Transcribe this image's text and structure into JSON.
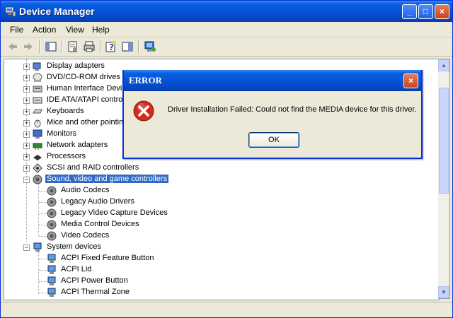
{
  "window": {
    "title": "Device Manager",
    "minimize": "_",
    "maximize": "□",
    "close": "×"
  },
  "menu": [
    {
      "label": "File"
    },
    {
      "label": "Action"
    },
    {
      "label": "View"
    },
    {
      "label": "Help"
    }
  ],
  "toolbar": {
    "icons": [
      "back-arrow-icon",
      "forward-arrow-icon",
      "show-hide-tree-icon",
      "properties-icon",
      "print-icon",
      "help-icon",
      "view-toggle-icon",
      "scan-hardware-icon"
    ]
  },
  "tree": {
    "categories": [
      {
        "label": "Display adapters",
        "icon": "display-adapter-icon",
        "expander": "+"
      },
      {
        "label": "DVD/CD-ROM drives",
        "icon": "cdrom-icon",
        "expander": "+"
      },
      {
        "label": "Human Interface Devic",
        "icon": "hid-icon",
        "expander": "+"
      },
      {
        "label": "IDE ATA/ATAPI contro",
        "icon": "ide-icon",
        "expander": "+"
      },
      {
        "label": "Keyboards",
        "icon": "keyboard-icon",
        "expander": "+"
      },
      {
        "label": "Mice and other pointin",
        "icon": "mouse-icon",
        "expander": "+"
      },
      {
        "label": "Monitors",
        "icon": "monitor-icon",
        "expander": "+"
      },
      {
        "label": "Network adapters",
        "icon": "network-icon",
        "expander": "+"
      },
      {
        "label": "Processors",
        "icon": "processor-icon",
        "expander": "+"
      },
      {
        "label": "SCSI and RAID controllers",
        "icon": "scsi-icon",
        "expander": "+"
      },
      {
        "label": "Sound, video and game controllers",
        "icon": "sound-icon",
        "expander": "−",
        "selected": true
      },
      {
        "label": "System devices",
        "icon": "system-icon",
        "expander": "−"
      }
    ],
    "sound_children": [
      "Audio Codecs",
      "Legacy Audio Drivers",
      "Legacy Video Capture Devices",
      "Media Control Devices",
      "Video Codecs"
    ],
    "system_children": [
      "ACPI Fixed Feature Button",
      "ACPI Lid",
      "ACPI Power Button",
      "ACPI Thermal Zone"
    ]
  },
  "dialog": {
    "title": "ERROR",
    "close": "×",
    "icon": "error-icon",
    "message": "Driver Installation Failed: Could not find the MEDIA device for this driver.",
    "ok_label": "OK"
  },
  "colors": {
    "titlebar": "#0553d6",
    "selection": "#316ac5",
    "error_red": "#d32a1d"
  }
}
